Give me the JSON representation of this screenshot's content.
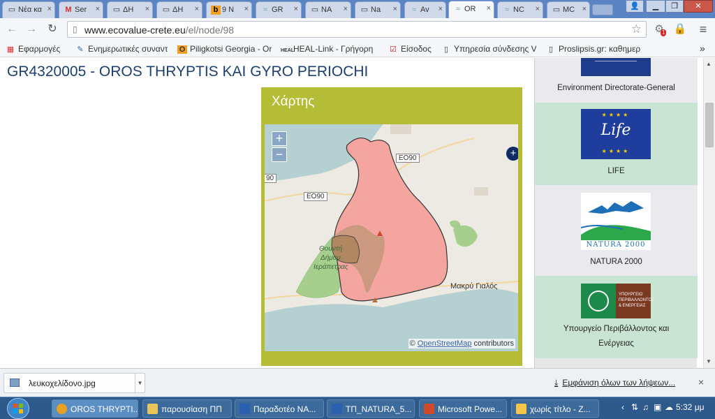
{
  "browser": {
    "tabs": [
      {
        "title": "Νέα κα",
        "icon": "page-icon"
      },
      {
        "title": "Ser",
        "icon": "gmail-icon"
      },
      {
        "title": "ΔΗ",
        "icon": "page-icon"
      },
      {
        "title": "ΔΗ",
        "icon": "page-icon"
      },
      {
        "title": "9 N",
        "icon": "bookmark-icon"
      },
      {
        "title": "GR",
        "icon": "wave-icon"
      },
      {
        "title": "NA",
        "icon": "page-icon"
      },
      {
        "title": "Na",
        "icon": "page-icon"
      },
      {
        "title": "Av",
        "icon": "wave-icon"
      },
      {
        "title": "OR",
        "icon": "wave-icon"
      },
      {
        "title": "NC",
        "icon": "wave-icon"
      },
      {
        "title": "MC",
        "icon": "page-icon"
      }
    ],
    "close_glyph": "×",
    "url_host": "www.ecovalue-crete.eu",
    "url_path": "/el/node/98",
    "extension_badge": "1",
    "bookmarks": [
      {
        "label": "Εφαρμογές",
        "icon": "apps-icon"
      },
      {
        "label": "Ενημερωτικές συναντ",
        "icon": "pen-icon"
      },
      {
        "label": "Piligkotsi Georgia - Or",
        "icon": "orange-o-icon"
      },
      {
        "label": "HEAL-Link - Γρήγορη",
        "icon": "heal-icon"
      },
      {
        "label": "Είσοδος",
        "icon": "check-icon"
      },
      {
        "label": "Υπηρεσία σύνδεσης V",
        "icon": "page-icon"
      },
      {
        "label": "Proslipsis.gr: καθημερ",
        "icon": "page-icon"
      }
    ],
    "bookmarks_more": "»"
  },
  "page": {
    "title": "GR4320005 - OROS THRYPTIS KAI GYRO PERIOCHI",
    "map_block_title": "Χάρτης",
    "map": {
      "zoom_in": "+",
      "zoom_out": "−",
      "layer_switch": "+",
      "attribution_prefix": "©",
      "attribution_link": "OpenStreetMap",
      "attribution_suffix": "contributors",
      "labels": {
        "road1": "EO90",
        "road2": "EO90",
        "road3": "90",
        "town": "Μακρύ Γιαλός",
        "area_line1": "Θουντή",
        "area_line2": "Δήμου",
        "area_line3": "Ιεράπετρας"
      },
      "colors": {
        "sea": "#b5d0d0",
        "land": "#eceae2",
        "site": "#f4a5a0",
        "forest": "#a6cf8e"
      }
    },
    "sidebar": [
      {
        "label": "Environment Directorate-General",
        "style": "grey"
      },
      {
        "label": "LIFE",
        "style": "green",
        "logo_text": "Life"
      },
      {
        "label": "NATURA 2000",
        "style": "grey",
        "logo_text": "NATURA 2000"
      },
      {
        "label_line1": "Υπουργείο Περιβάλλοντος και",
        "label_line2": "Ενέργειας",
        "style": "green",
        "logo_text_line1": "ΥΠΟΥΡΓΕΙΟ",
        "logo_text_line2": "ΠΕΡΙΒΑΛΛΟΝΤΟΣ",
        "logo_text_line3": "& ΕΝΕΡΓΕΙΑΣ"
      }
    ]
  },
  "downloads": {
    "file_name": "λευκοχελίδονο.jpg",
    "show_all": "Εμφάνιση όλων των λήψεων...",
    "close": "×"
  },
  "taskbar": {
    "items": [
      {
        "label": "OROS THRYPTI...",
        "color": "#e8a020"
      },
      {
        "label": "παρουσίαση ΠΠ",
        "color": "#e8c45a"
      },
      {
        "label": "Παραδοτέο ΝΑ...",
        "color": "#2b5fb0"
      },
      {
        "label": "ΤΠ_NATURA_5...",
        "color": "#2b5fb0"
      },
      {
        "label": "Microsoft Powe...",
        "color": "#d2492a"
      },
      {
        "label": "χωρίς τίτλο - Ζ...",
        "color": "#f3c64a"
      }
    ],
    "clock": "5:32 μμ"
  }
}
